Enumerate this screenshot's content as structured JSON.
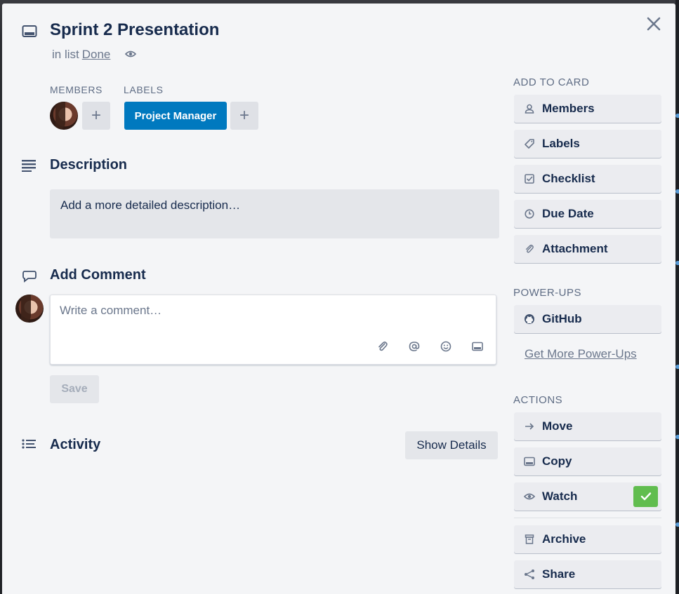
{
  "card": {
    "title": "Sprint 2 Presentation",
    "in_list_prefix": "in list",
    "list_name": "Done"
  },
  "members": {
    "label": "MEMBERS",
    "add": "+"
  },
  "labels": {
    "label": "LABELS",
    "items": [
      {
        "text": "Project Manager",
        "color": "#0079bf"
      }
    ],
    "add": "+"
  },
  "description": {
    "heading": "Description",
    "placeholder": "Add a more detailed description…"
  },
  "comment": {
    "heading": "Add Comment",
    "placeholder": "Write a comment…",
    "save_label": "Save"
  },
  "activity": {
    "heading": "Activity",
    "show_details_label": "Show Details"
  },
  "sidebar": {
    "add_to_card_label": "ADD TO CARD",
    "add_to_card": [
      {
        "label": "Members",
        "icon": "person-icon"
      },
      {
        "label": "Labels",
        "icon": "tag-icon"
      },
      {
        "label": "Checklist",
        "icon": "checkbox-icon"
      },
      {
        "label": "Due Date",
        "icon": "clock-icon"
      },
      {
        "label": "Attachment",
        "icon": "paperclip-icon"
      }
    ],
    "power_ups_label": "POWER-UPS",
    "power_ups": [
      {
        "label": "GitHub",
        "icon": "github-icon"
      }
    ],
    "get_more_label": "Get More Power-Ups",
    "actions_label": "ACTIONS",
    "actions": [
      {
        "label": "Move",
        "icon": "arrow-right-icon"
      },
      {
        "label": "Copy",
        "icon": "card-icon"
      },
      {
        "label": "Watch",
        "icon": "eye-icon",
        "active": true
      },
      {
        "label": "Archive",
        "icon": "archive-icon"
      },
      {
        "label": "Share",
        "icon": "share-icon"
      }
    ]
  },
  "colors": {
    "accent": "#0079bf",
    "success": "#61bd4f",
    "panel_bg": "#f4f5f7",
    "button_bg": "#ebecf0"
  }
}
